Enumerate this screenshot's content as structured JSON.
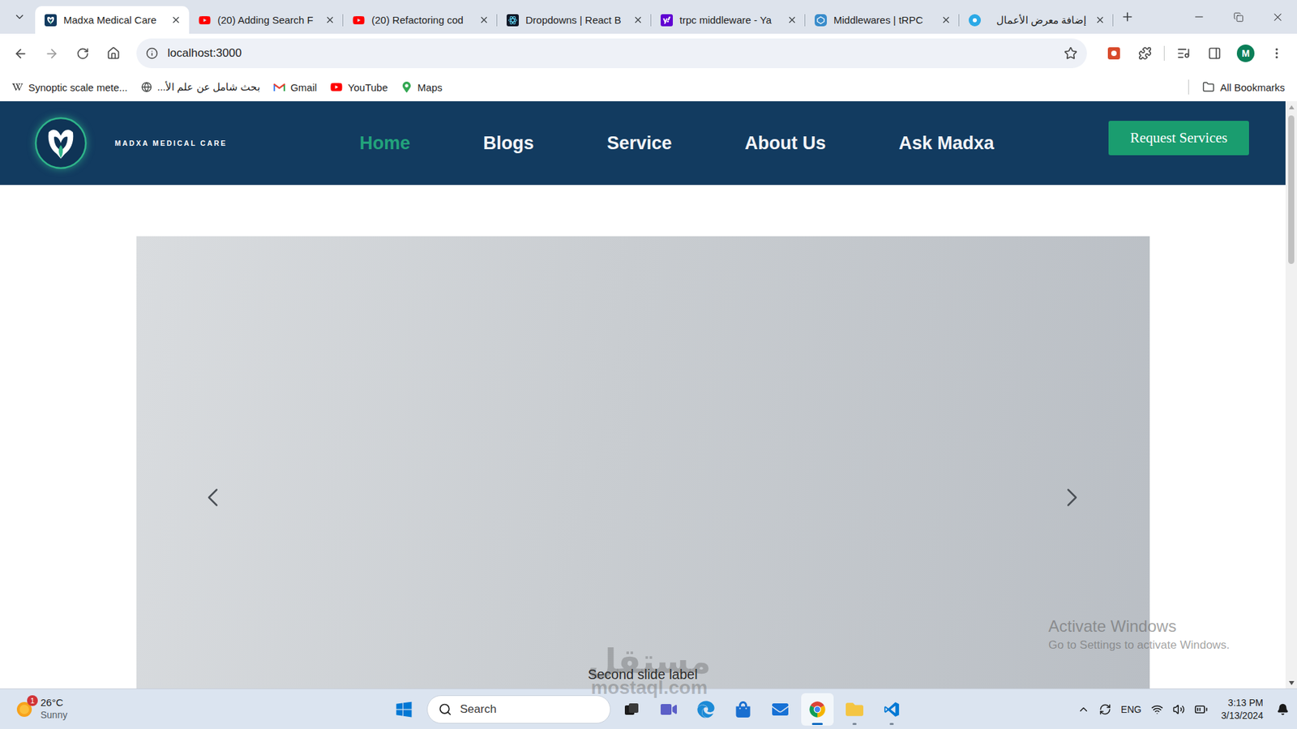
{
  "tabs": [
    {
      "label": "Madxa Medical Care",
      "selected": true,
      "kind": "madxa"
    },
    {
      "label": "(20) Adding Search F",
      "selected": false,
      "kind": "youtube"
    },
    {
      "label": "(20) Refactoring cod",
      "selected": false,
      "kind": "youtube"
    },
    {
      "label": "Dropdowns | React B",
      "selected": false,
      "kind": "react-bootstrap"
    },
    {
      "label": "trpc middleware - Ya",
      "selected": false,
      "kind": "yahoo"
    },
    {
      "label": "Middlewares | tRPC",
      "selected": false,
      "kind": "trpc"
    },
    {
      "label": "إضافة معرض الأعمال",
      "selected": false,
      "kind": "mostaql"
    }
  ],
  "address_bar": {
    "url": "localhost:3000"
  },
  "profile": {
    "initial": "M"
  },
  "bookmarks": [
    {
      "label": "Synoptic scale mete...",
      "kind": "wikipedia"
    },
    {
      "label": "بحث شامل عن علم الأ...",
      "kind": "globe"
    },
    {
      "label": "Gmail",
      "kind": "gmail"
    },
    {
      "label": "YouTube",
      "kind": "youtube"
    },
    {
      "label": "Maps",
      "kind": "maps"
    }
  ],
  "all_bookmarks": "All Bookmarks",
  "site": {
    "brand": "MADXA MEDICAL CARE",
    "nav": [
      {
        "label": "Home",
        "selected": true
      },
      {
        "label": "Blogs",
        "selected": false
      },
      {
        "label": "Service",
        "selected": false
      },
      {
        "label": "About Us",
        "selected": false
      },
      {
        "label": "Ask Madxa",
        "selected": false
      }
    ],
    "cta": "Request Services",
    "carousel": {
      "caption": "Second slide label"
    }
  },
  "taskbar": {
    "weather": {
      "temp": "26°C",
      "condition": "Sunny",
      "badge": "1"
    },
    "search": {
      "placeholder": "Search"
    },
    "apps": [
      {
        "kind": "taskview",
        "selected": false,
        "running": false
      },
      {
        "kind": "meet",
        "selected": false,
        "running": false
      },
      {
        "kind": "edge",
        "selected": false,
        "running": false
      },
      {
        "kind": "store",
        "selected": false,
        "running": false
      },
      {
        "kind": "mail",
        "selected": false,
        "running": false
      },
      {
        "kind": "chrome",
        "selected": true,
        "running": true
      },
      {
        "kind": "explorer",
        "selected": false,
        "running": true
      },
      {
        "kind": "vscode",
        "selected": false,
        "running": true
      }
    ],
    "tray": {
      "language": "ENG",
      "time": "3:13 PM",
      "date": "3/13/2024"
    }
  },
  "overlays": {
    "activation": {
      "title": "Activate Windows",
      "subtitle": "Go to Settings to activate Windows."
    },
    "watermark": {
      "arabic": "مستقل",
      "latin": "mostaql.com"
    }
  }
}
